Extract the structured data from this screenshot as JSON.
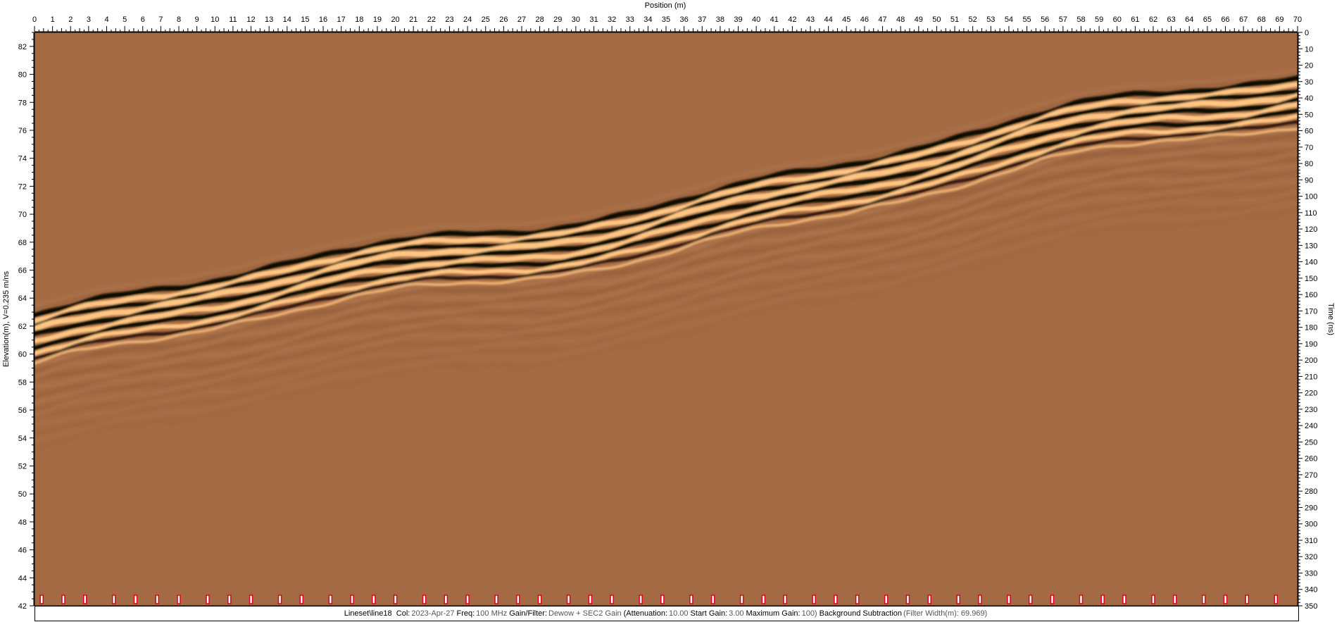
{
  "window": {
    "x_axis_title": "Position (m)",
    "left_axis_title": "Elevation(m), V=0.235 m/ns",
    "right_axis_title": "Time (ns)"
  },
  "axes": {
    "position_ticks": [
      "0",
      "1",
      "2",
      "3",
      "4",
      "5",
      "6",
      "7",
      "8",
      "9",
      "10",
      "11",
      "12",
      "13",
      "14",
      "15",
      "16",
      "17",
      "18",
      "19",
      "20",
      "21",
      "22",
      "23",
      "24",
      "25",
      "26",
      "27",
      "28",
      "29",
      "30",
      "31",
      "32",
      "33",
      "34",
      "35",
      "36",
      "37",
      "38",
      "39",
      "40",
      "41",
      "42",
      "43",
      "44",
      "45",
      "46",
      "47",
      "48",
      "49",
      "50",
      "51",
      "52",
      "53",
      "54",
      "55",
      "56",
      "57",
      "58",
      "59",
      "60",
      "61",
      "62",
      "63",
      "64",
      "65",
      "66",
      "67",
      "68",
      "69",
      "70"
    ],
    "position_range": [
      0,
      70
    ],
    "elevation_ticks": [
      "82",
      "80",
      "78",
      "76",
      "74",
      "72",
      "70",
      "68",
      "66",
      "64",
      "62",
      "60",
      "58",
      "56",
      "54",
      "52",
      "50",
      "48",
      "46",
      "44",
      "42"
    ],
    "elevation_range": [
      42,
      83
    ],
    "time_ticks": [
      "0",
      "10",
      "20",
      "30",
      "40",
      "50",
      "60",
      "70",
      "80",
      "90",
      "100",
      "110",
      "120",
      "130",
      "140",
      "150",
      "160",
      "170",
      "180",
      "190",
      "200",
      "210",
      "220",
      "230",
      "240",
      "250",
      "260",
      "270",
      "280",
      "290",
      "300",
      "310",
      "320",
      "330",
      "340",
      "350"
    ],
    "time_range": [
      0,
      350
    ]
  },
  "radargram": {
    "background_color": "#a46a43",
    "dark_color": "#0b0703",
    "light_color": "#ffc683",
    "surface_elevation_start": 62.5,
    "surface_elevation_end": 80.0
  },
  "markers": {
    "color": "#e0001c",
    "positions": [
      0.4,
      1.6,
      2.8,
      4.4,
      5.6,
      6.8,
      8.0,
      9.6,
      10.8,
      12.0,
      13.6,
      14.8,
      16.4,
      17.6,
      18.8,
      20.0,
      21.6,
      22.8,
      24.0,
      25.6,
      26.8,
      28.0,
      29.6,
      30.8,
      32.0,
      33.6,
      34.8,
      36.4,
      37.6,
      39.2,
      40.4,
      41.6,
      43.2,
      44.4,
      45.6,
      47.2,
      48.4,
      49.6,
      51.2,
      52.4,
      54.0,
      55.2,
      56.4,
      58.0,
      59.2,
      60.4,
      62.0,
      63.2,
      64.8,
      66.0,
      67.2,
      68.8
    ]
  },
  "status": {
    "file": "Lineset\\line18",
    "col_label": "Col:",
    "col_value": "2023-Apr-27",
    "freq_label": "Freq:",
    "freq_value": "100 MHz",
    "gain_label": "Gain/Filter:",
    "gain_value": "Dewow + SEC2 Gain",
    "att_open": "(Attenuation:",
    "att_value": "10.00",
    "start_label": "Start Gain:",
    "start_value": "3.00",
    "max_label": "Maximum Gain:",
    "max_value": "100)",
    "bg_label": "Background Subtraction",
    "filter_value": "(Filter Width(m): 69.969)"
  }
}
